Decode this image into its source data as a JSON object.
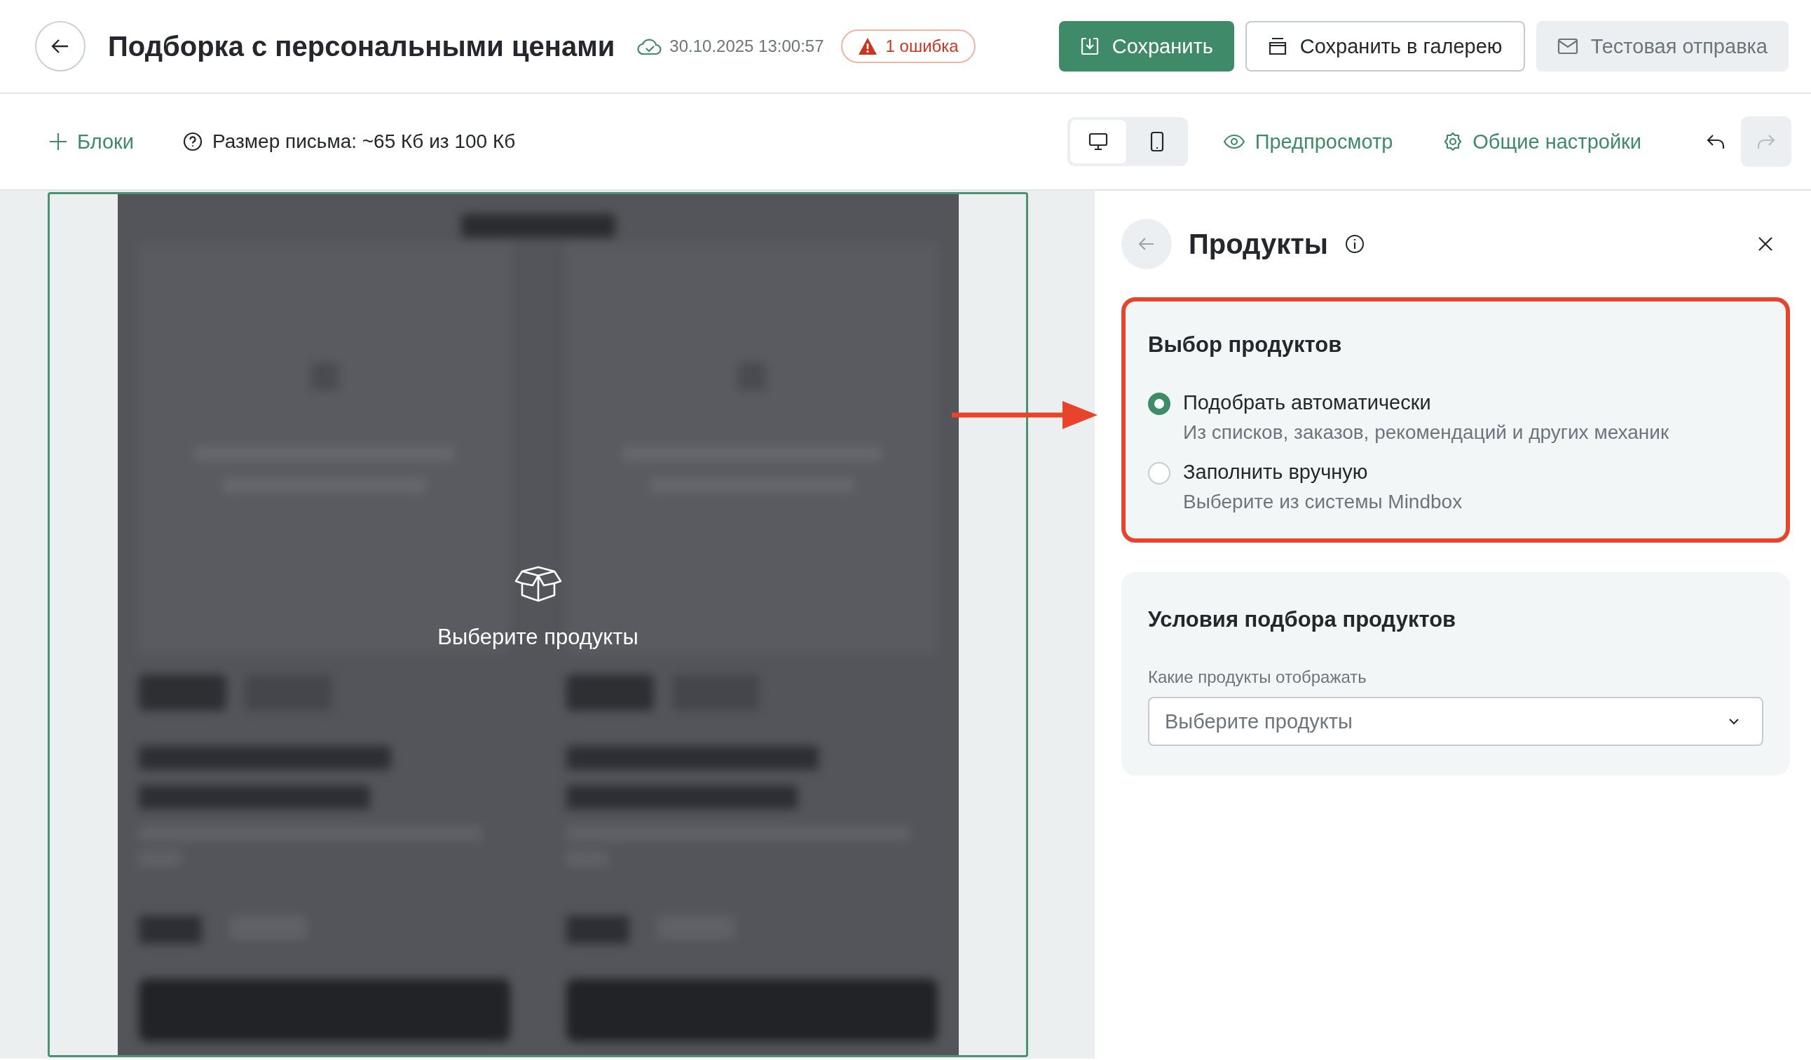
{
  "header": {
    "title": "Подборка с персональными ценами",
    "saved_time": "30.10.2025 13:00:57",
    "error_badge": "1 ошибка",
    "buttons": [
      {
        "label": "Сохранить",
        "kind": "primary"
      },
      {
        "label": "Сохранить в галерею",
        "kind": "secondary"
      },
      {
        "label": "Тестовая отправка",
        "kind": "muted"
      }
    ]
  },
  "toolbar": {
    "blocks_button": "Блоки",
    "size_info": "Размер письма: ~65 Кб из 100 Кб",
    "devices": [
      {
        "kind": "desktop",
        "selected": true
      },
      {
        "kind": "mobile",
        "selected": false
      }
    ],
    "links": [
      {
        "label": "Предпросмотр",
        "kind": "preview"
      },
      {
        "label": "Общие настройки",
        "kind": "settings"
      }
    ],
    "undo": {
      "disabled": false
    },
    "redo": {
      "disabled": true
    }
  },
  "preview": {
    "overlay_text": "Выберите продукты"
  },
  "panel": {
    "title": "Продукты",
    "sections": [
      {
        "kind": "radio-group",
        "title": "Выбор продуктов",
        "highlighted": true,
        "options": [
          {
            "label": "Подобрать автоматически",
            "description": "Из списков, заказов, рекомендаций и других механик",
            "selected": true
          },
          {
            "label": "Заполнить вручную",
            "description": "Выберите из системы Mindbox",
            "selected": false
          }
        ]
      },
      {
        "kind": "select",
        "title": "Условия подбора продуктов",
        "highlighted": false,
        "field": {
          "label": "Какие продукты отображать",
          "placeholder": "Выберите продукты"
        }
      }
    ]
  }
}
